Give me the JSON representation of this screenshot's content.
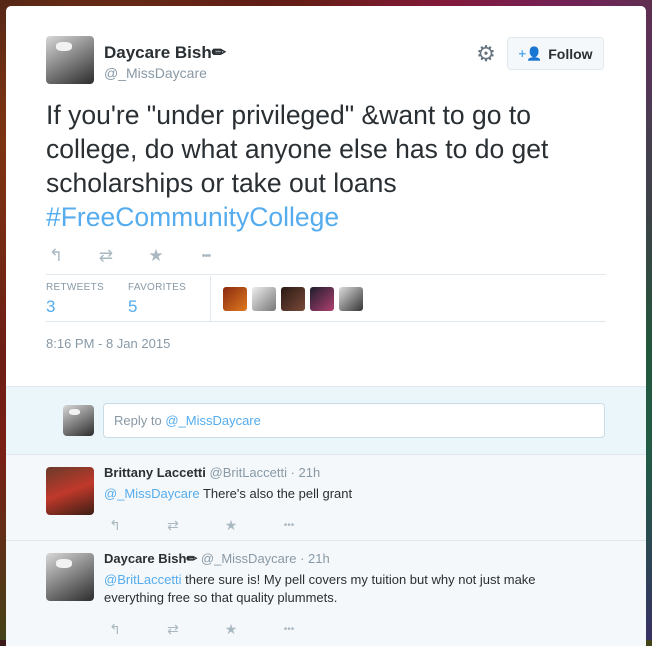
{
  "author": {
    "name": "Daycare Bish✏",
    "handle": "@_MissDaycare"
  },
  "header": {
    "follow_label": "Follow",
    "follow_icon": "+👤"
  },
  "tweet": {
    "text": "If you're \"under privileged\" &want to go to college, do what anyone else has to do get scholarships or take out loans",
    "hashtag": "#FreeCommunityCollege",
    "timestamp": "8:16 PM - 8 Jan 2015"
  },
  "actions": {
    "reply_icon": "↰",
    "retweet_icon": "⇄",
    "favorite_icon": "★",
    "more_icon": "•••"
  },
  "stats": {
    "retweets_label": "RETWEETS",
    "retweets_value": "3",
    "favorites_label": "FAVORITES",
    "favorites_value": "5"
  },
  "reply_box": {
    "prefix": "Reply to ",
    "mention": "@_MissDaycare"
  },
  "replies": [
    {
      "name": "Brittany Laccetti",
      "meta": "@BritLaccetti · 21h",
      "mention": "@_MissDaycare",
      "text": " There's also the pell grant"
    },
    {
      "name": "Daycare Bish✏",
      "meta": "@_MissDaycare · 21h",
      "mention": "@BritLaccetti",
      "text": " there sure is! My pell covers my tuition but why not just make everything free so that quality plummets."
    }
  ],
  "colors": {
    "accent": "#55acee",
    "text": "#292f33",
    "muted": "#8899a6",
    "icon": "#aab8c2"
  }
}
